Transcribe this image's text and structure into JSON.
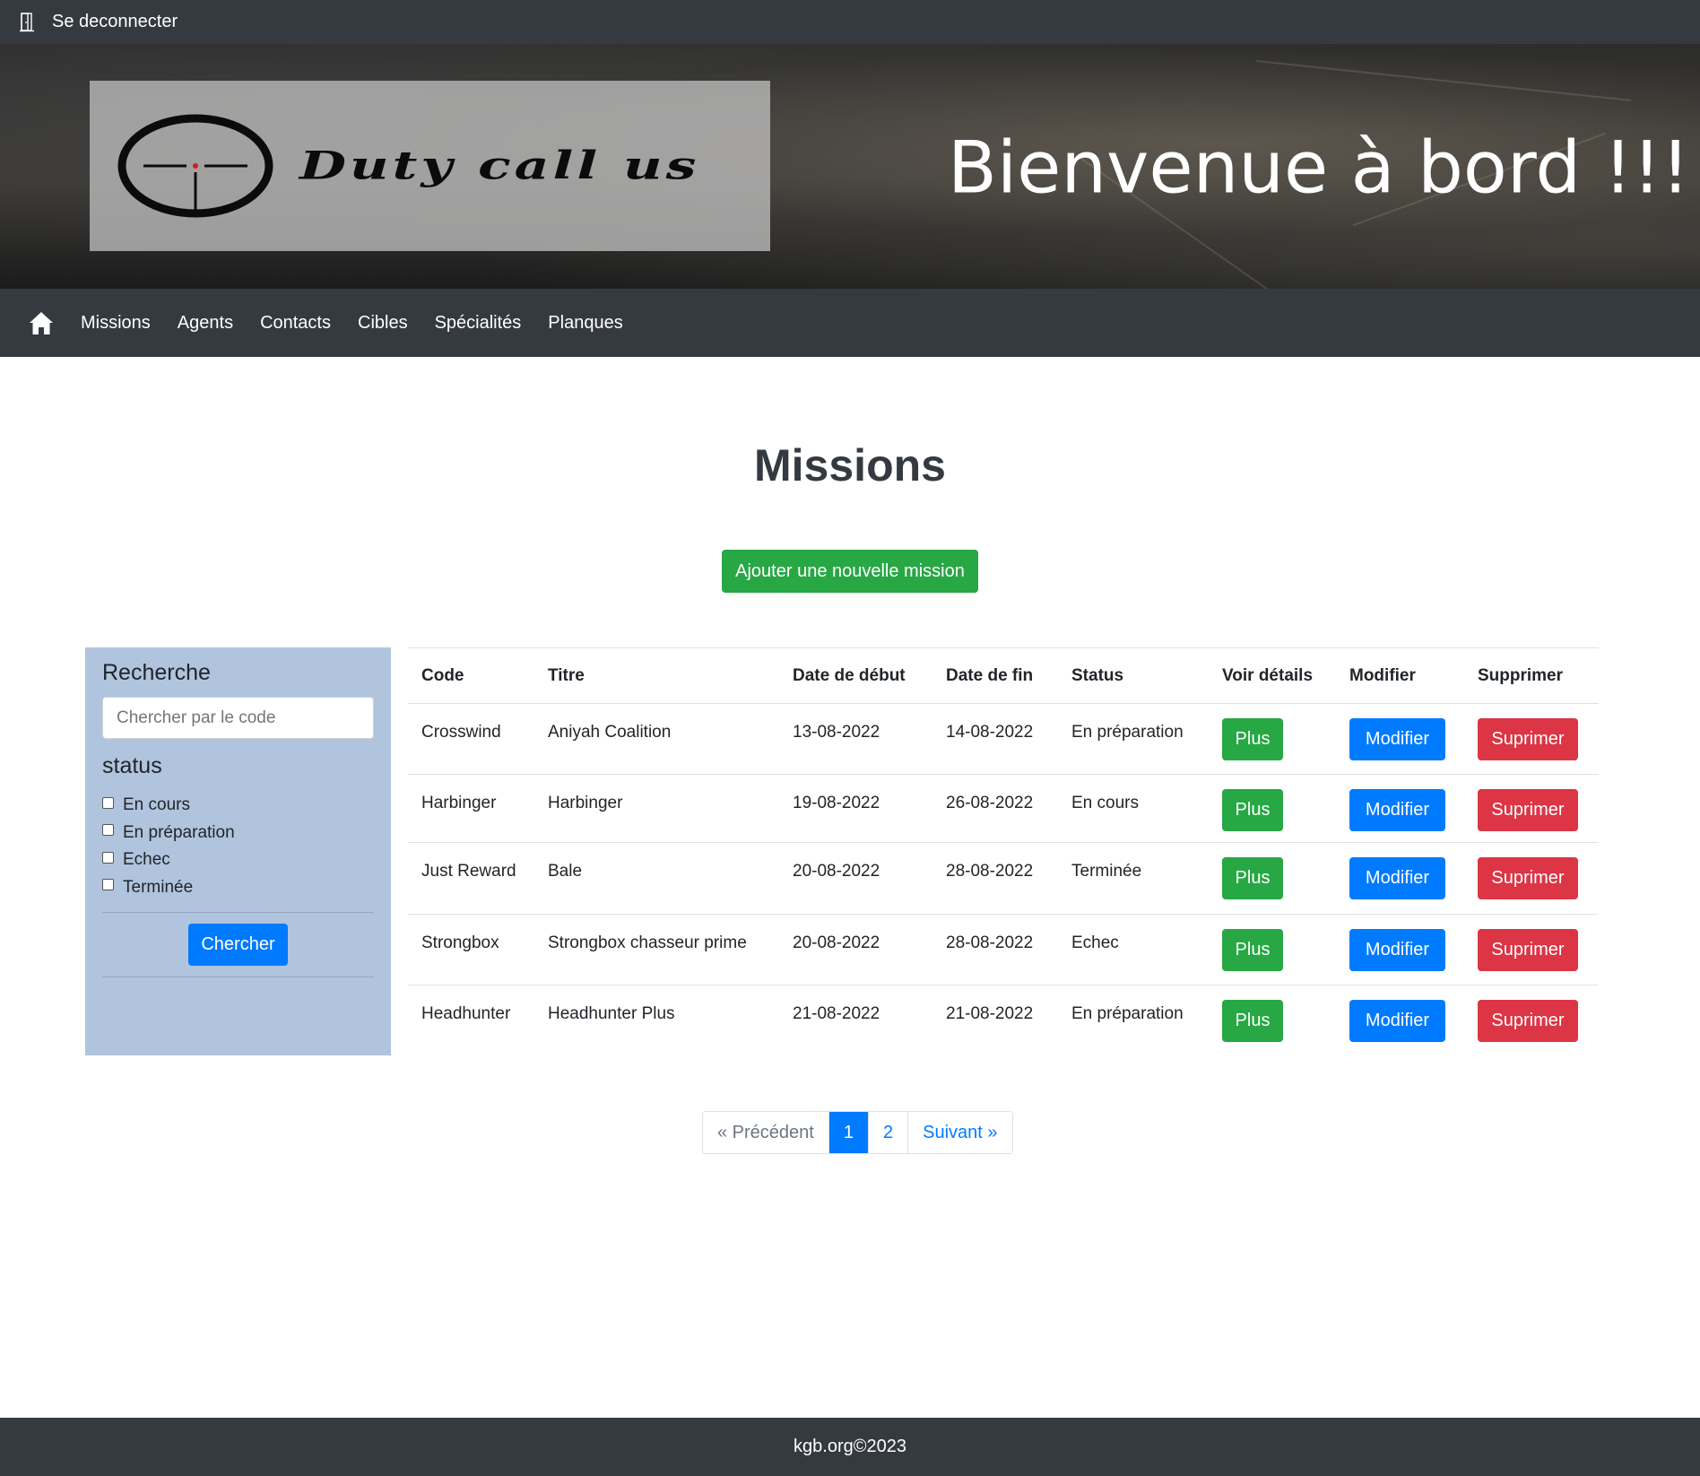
{
  "topbar": {
    "logout_label": "Se deconnecter"
  },
  "banner": {
    "logo_text": "Duty call us",
    "welcome": "Bienvenue à bord !!!"
  },
  "nav": {
    "items": [
      "Missions",
      "Agents",
      "Contacts",
      "Cibles",
      "Spécialités",
      "Planques"
    ]
  },
  "main": {
    "title": "Missions",
    "add_button": "Ajouter une nouvelle mission"
  },
  "sidebar": {
    "title": "Recherche",
    "search_placeholder": "Chercher par le code",
    "status_title": "status",
    "statuses": [
      "En cours",
      "En préparation",
      "Echec",
      "Terminée"
    ],
    "search_button": "Chercher"
  },
  "table": {
    "headers": [
      "Code",
      "Titre",
      "Date de début",
      "Date de fin",
      "Status",
      "Voir détails",
      "Modifier",
      "Supprimer"
    ],
    "rows": [
      {
        "code": "Crosswind",
        "title": "Aniyah Coalition",
        "start": "13-08-2022",
        "end": "14-08-2022",
        "status": "En préparation"
      },
      {
        "code": "Harbinger",
        "title": "Harbinger",
        "start": "19-08-2022",
        "end": "26-08-2022",
        "status": "En cours"
      },
      {
        "code": "Just Reward",
        "title": "Bale",
        "start": "20-08-2022",
        "end": "28-08-2022",
        "status": "Terminée"
      },
      {
        "code": "Strongbox",
        "title": "Strongbox chasseur prime",
        "start": "20-08-2022",
        "end": "28-08-2022",
        "status": "Echec"
      },
      {
        "code": "Headhunter",
        "title": "Headhunter Plus",
        "start": "21-08-2022",
        "end": "21-08-2022",
        "status": "En préparation"
      }
    ],
    "buttons": {
      "details": "Plus",
      "edit": "Modifier",
      "delete": "Suprimer"
    }
  },
  "pagination": {
    "prev": "« Précédent",
    "pages": [
      "1",
      "2"
    ],
    "active_page": "1",
    "next": "Suivant »"
  },
  "footer": {
    "text": "kgb.org©2023"
  },
  "colors": {
    "dark": "#343a40",
    "success": "#28a745",
    "primary": "#007bff",
    "danger": "#dc3545",
    "sidebar": "#b0c4de"
  },
  "icons": {
    "logout": "door-icon",
    "home": "home-icon",
    "logo": "crosshair-icon"
  }
}
